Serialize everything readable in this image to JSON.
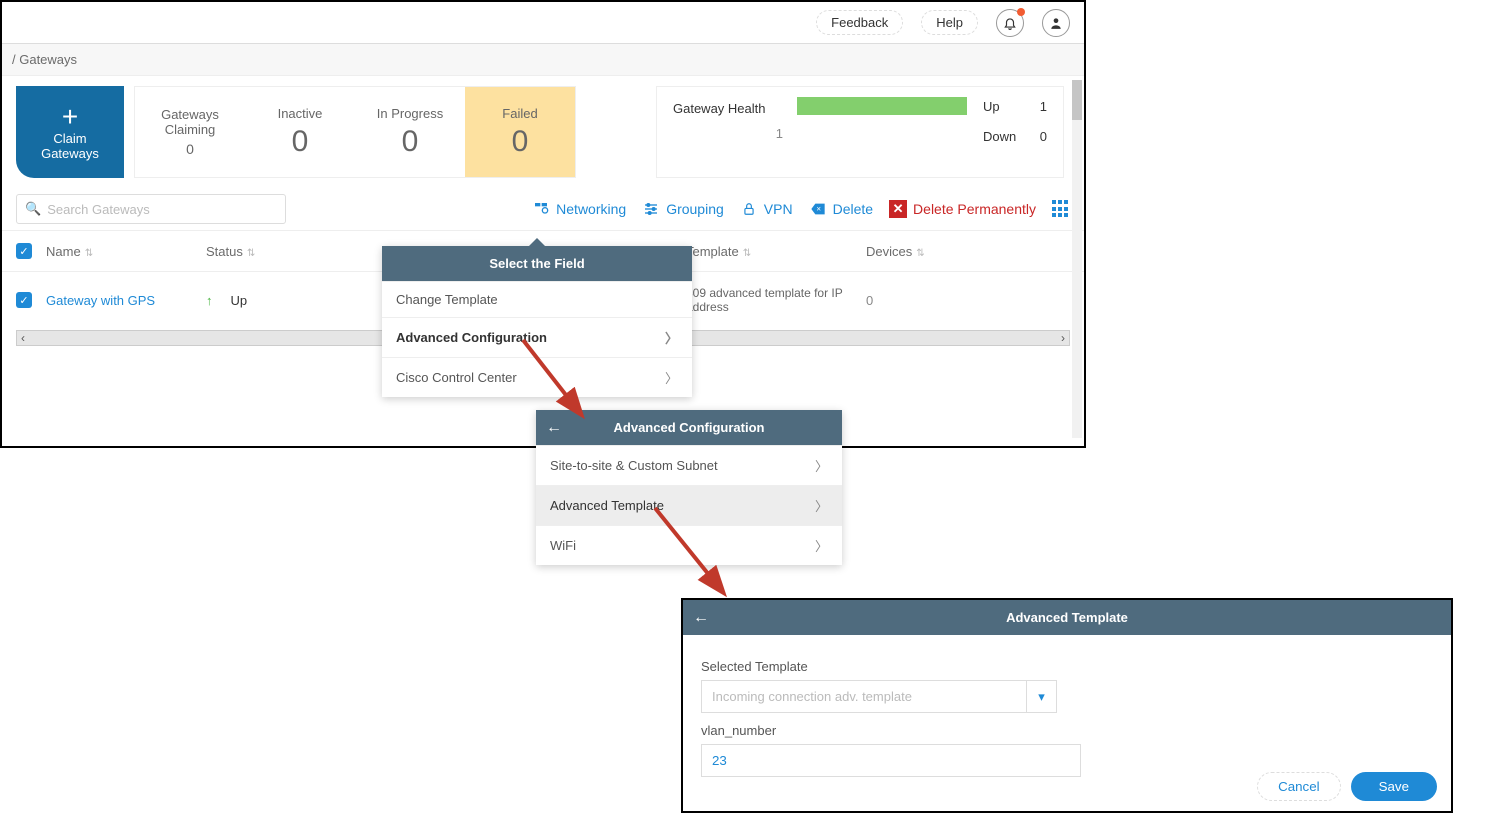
{
  "topbar": {
    "feedback": "Feedback",
    "help": "Help",
    "bell_icon": "bell",
    "user_icon": "user"
  },
  "breadcrumb": "/ Gateways",
  "claim": {
    "title1": "Claim",
    "title2": "Gateways"
  },
  "metrics": {
    "claiming": {
      "label": "Gateways Claiming",
      "value": "0"
    },
    "inactive": {
      "label": "Inactive",
      "value": "0"
    },
    "inprogress": {
      "label": "In Progress",
      "value": "0"
    },
    "failed": {
      "label": "Failed",
      "value": "0"
    }
  },
  "health": {
    "title": "Gateway Health",
    "total": "1",
    "up_label": "Up",
    "up_value": "1",
    "down_label": "Down",
    "down_value": "0"
  },
  "search": {
    "placeholder": "Search Gateways"
  },
  "toolbar": {
    "networking": "Networking",
    "grouping": "Grouping",
    "vpn": "VPN",
    "delete": "Delete",
    "delete_perm": "Delete Permanently"
  },
  "table": {
    "headers": {
      "name": "Name",
      "status": "Status",
      "template": "Template",
      "devices": "Devices"
    },
    "row": {
      "name": "Gateway with GPS",
      "status": "Up",
      "template": "809 advanced template for IP address",
      "devices": "0"
    }
  },
  "popover1": {
    "title": "Select the Field",
    "items": [
      "Change Template",
      "Advanced Configuration",
      "Cisco Control Center"
    ]
  },
  "popover2": {
    "title": "Advanced Configuration",
    "items": [
      "Site-to-site & Custom Subnet",
      "Advanced Template",
      "WiFi"
    ]
  },
  "panel3": {
    "title": "Advanced Template",
    "selected_label": "Selected Template",
    "select_placeholder": "Incoming connection adv. template",
    "field_label": "vlan_number",
    "field_value": "23",
    "cancel": "Cancel",
    "save": "Save"
  }
}
